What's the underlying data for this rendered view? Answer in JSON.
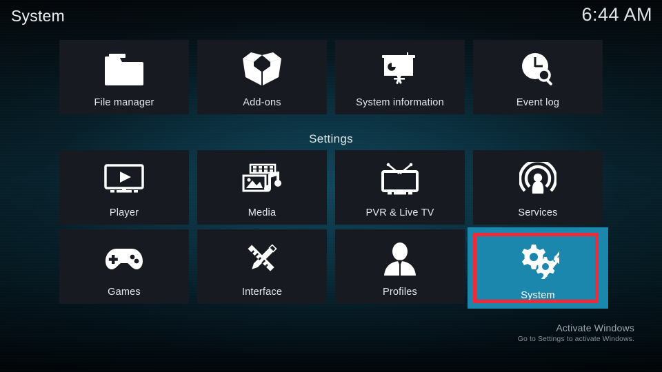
{
  "header": {
    "title": "System",
    "clock": "6:44 AM"
  },
  "sections": {
    "settings_heading": "Settings"
  },
  "colors": {
    "focus_background": "#1b87ad",
    "tile_background": "#171a20",
    "annotation_border": "#ef2b39",
    "text_primary": "#e2e8ec"
  },
  "top_row": [
    {
      "label": "File manager",
      "icon": "folder-icon",
      "selected": false
    },
    {
      "label": "Add-ons",
      "icon": "open-box-icon",
      "selected": false
    },
    {
      "label": "System information",
      "icon": "presentation-chart-icon",
      "selected": false
    },
    {
      "label": "Event log",
      "icon": "clock-search-icon",
      "selected": false
    }
  ],
  "settings_rows": [
    [
      {
        "label": "Player",
        "icon": "monitor-play-icon",
        "selected": false
      },
      {
        "label": "Media",
        "icon": "media-library-icon",
        "selected": false
      },
      {
        "label": "PVR & Live TV",
        "icon": "television-icon",
        "selected": false
      },
      {
        "label": "Services",
        "icon": "broadcast-icon",
        "selected": false
      }
    ],
    [
      {
        "label": "Games",
        "icon": "gamepad-icon",
        "selected": false
      },
      {
        "label": "Interface",
        "icon": "pencil-ruler-icon",
        "selected": false
      },
      {
        "label": "Profiles",
        "icon": "user-silhouette-icon",
        "selected": false
      },
      {
        "label": "System",
        "icon": "gear-wrench-icon",
        "selected": true
      }
    ]
  ],
  "annotation": {
    "target": "System",
    "shape": "rectangle",
    "color": "#ef2b39"
  },
  "watermark": {
    "title": "Activate Windows",
    "subtitle": "Go to Settings to activate Windows."
  }
}
